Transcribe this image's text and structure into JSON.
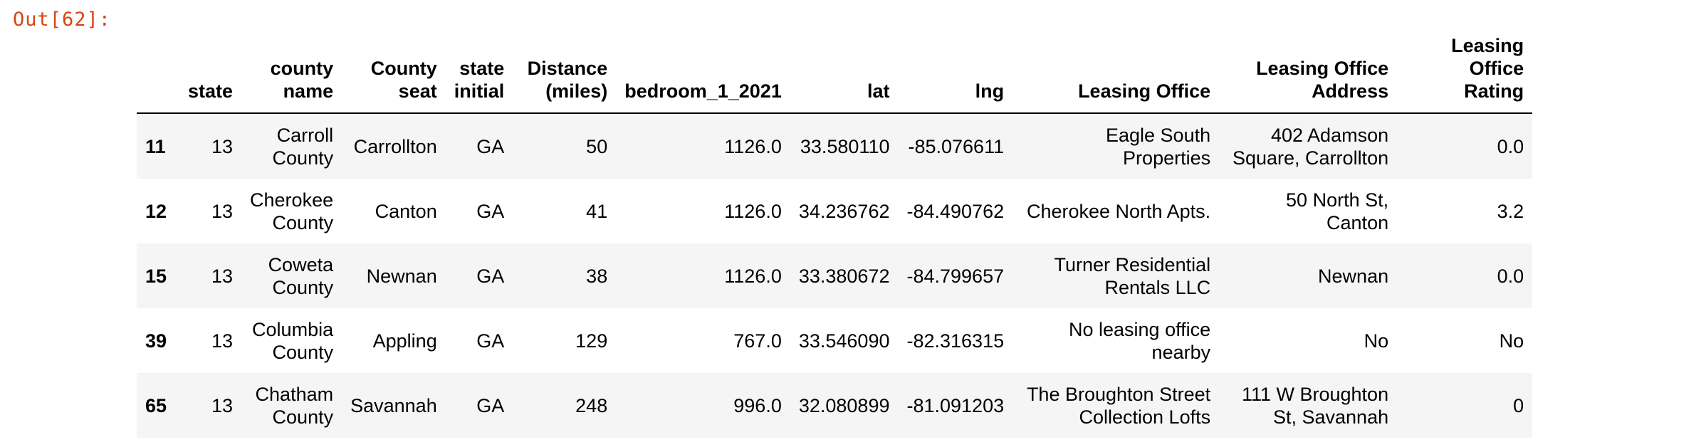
{
  "prompt": "Out[62]:",
  "columns": [
    "",
    "state",
    "county name",
    "County seat",
    "state initial",
    "Distance (miles)",
    "bedroom_1_2021",
    "lat",
    "lng",
    "Leasing Office",
    "Leasing Office Address",
    "Leasing Office Rating"
  ],
  "rows": [
    [
      "11",
      "13",
      "Carroll County",
      "Carrollton",
      "GA",
      "50",
      "1126.0",
      "33.580110",
      "-85.076611",
      "Eagle South Properties",
      "402 Adamson Square, Carrollton",
      "0.0"
    ],
    [
      "12",
      "13",
      "Cherokee County",
      "Canton",
      "GA",
      "41",
      "1126.0",
      "34.236762",
      "-84.490762",
      "Cherokee North Apts.",
      "50 North St, Canton",
      "3.2"
    ],
    [
      "15",
      "13",
      "Coweta County",
      "Newnan",
      "GA",
      "38",
      "1126.0",
      "33.380672",
      "-84.799657",
      "Turner Residential Rentals LLC",
      "Newnan",
      "0.0"
    ],
    [
      "39",
      "13",
      "Columbia County",
      "Appling",
      "GA",
      "129",
      "767.0",
      "33.546090",
      "-82.316315",
      "No leasing office nearby",
      "No",
      "No"
    ],
    [
      "65",
      "13",
      "Chatham County",
      "Savannah",
      "GA",
      "248",
      "996.0",
      "32.080899",
      "-81.091203",
      "The Broughton Street Collection Lofts",
      "111 W Broughton St, Savannah",
      "0"
    ]
  ],
  "colors": {
    "prompt": "#d84315",
    "row_stripe": "#f5f5f5"
  }
}
